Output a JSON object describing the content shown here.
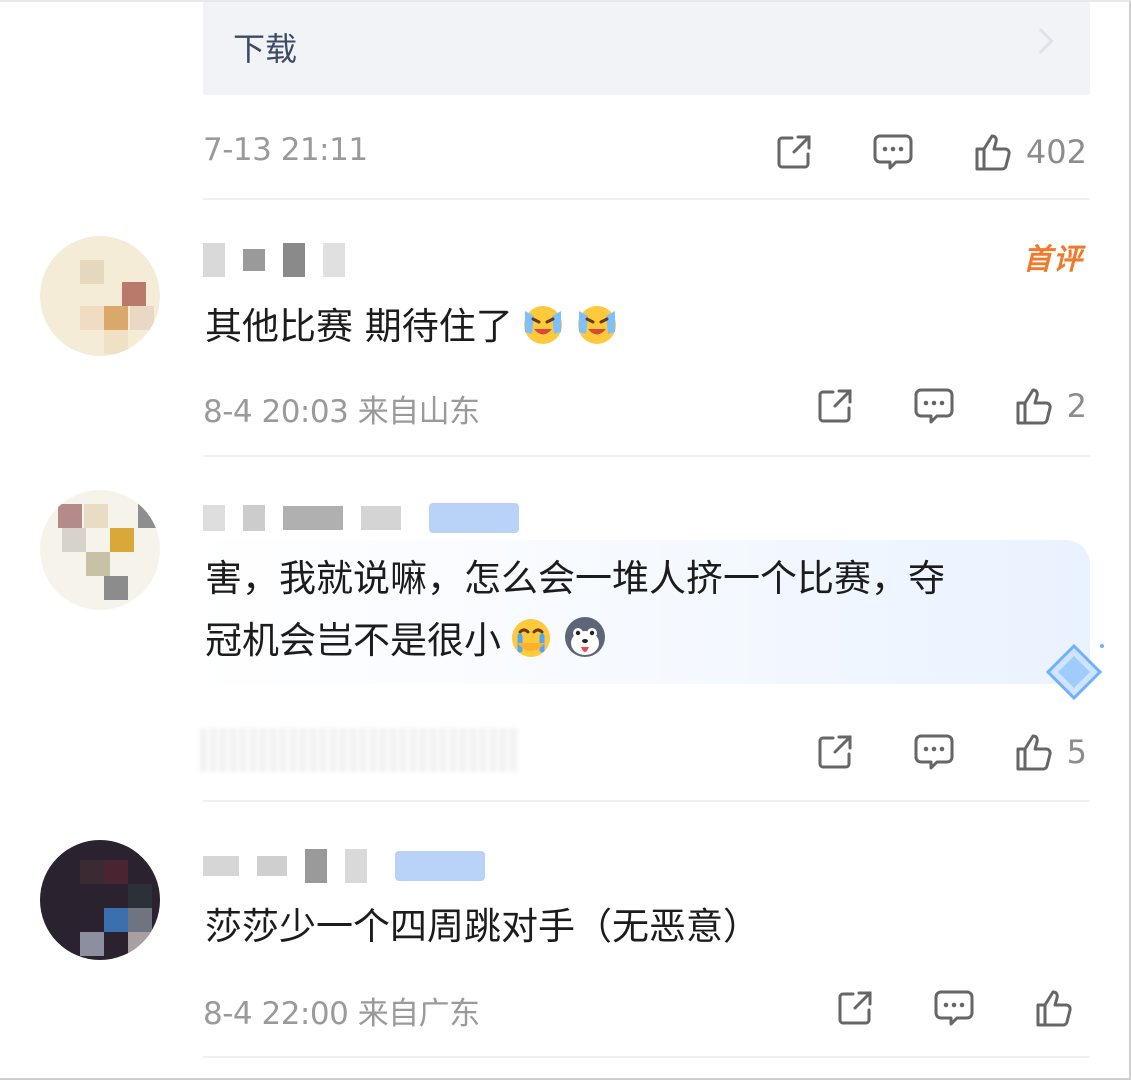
{
  "download": {
    "label": "下载"
  },
  "post": {
    "time": "7-13 21:11",
    "likes": "402"
  },
  "comments": [
    {
      "badge": "首评",
      "text": "其他比赛 期待住了",
      "emoji": [
        "laugh-cry-emoji",
        "laugh-cry-emoji"
      ],
      "time": "8-4 20:03",
      "location": "来自山东",
      "likes": "2"
    },
    {
      "text_line1": "害，我就说嘛，怎么会一堆人挤一个比赛，夺",
      "text_line2": "冠机会岂不是很小",
      "emoji": [
        "crying-emoji",
        "husky-emoji"
      ],
      "likes": "5"
    },
    {
      "text": "莎莎少一个四周跳对手（无恶意）",
      "time": "8-4 22:00",
      "location": "来自广东",
      "likes": ""
    }
  ],
  "colors": {
    "accent_orange": "#f07a2a",
    "meta_gray": "#9a9a9a",
    "card_bg": "#f2f3f7"
  }
}
